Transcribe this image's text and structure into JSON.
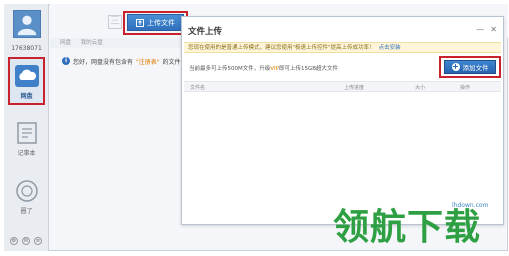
{
  "sidebar": {
    "user_id": "17638071",
    "items": [
      {
        "label": "网盘",
        "icon": "cloud-icon",
        "active": true
      },
      {
        "label": "记事本",
        "icon": "notepad-icon",
        "active": false
      },
      {
        "label": "圈了",
        "icon": "circle-icon",
        "active": false
      }
    ],
    "bottom_icons": [
      "settings-icon",
      "chat-icon",
      "menu-icon"
    ]
  },
  "toolbar": {
    "upload_label": "上传文件"
  },
  "breadcrumb": {
    "items": [
      "网盘",
      "我的云盘"
    ]
  },
  "notice": {
    "prefix": "您好，网盘没有包含有",
    "highlight": "\"注册表\"",
    "suffix": "的文件"
  },
  "dialog": {
    "title": "文件上传",
    "warning_text": "您现在使用的是普通上传模式，建议您使用\"极速上传控件\"提高上传成功率！",
    "warning_link": "点击安装",
    "quota_prefix": "当前最多可上传500M文件，升级",
    "quota_vip": "VIP",
    "quota_suffix": "即可上传15GB超大文件",
    "add_label": "添加文件",
    "columns": [
      "文件名",
      "上传进度",
      "大小",
      "操作"
    ]
  },
  "watermark": {
    "url": "lhdown.com",
    "text": "领航下载"
  },
  "colors": {
    "highlight_box": "#c8232c",
    "primary_button": "#2f6fbc",
    "watermark_green": "#2ea043"
  }
}
